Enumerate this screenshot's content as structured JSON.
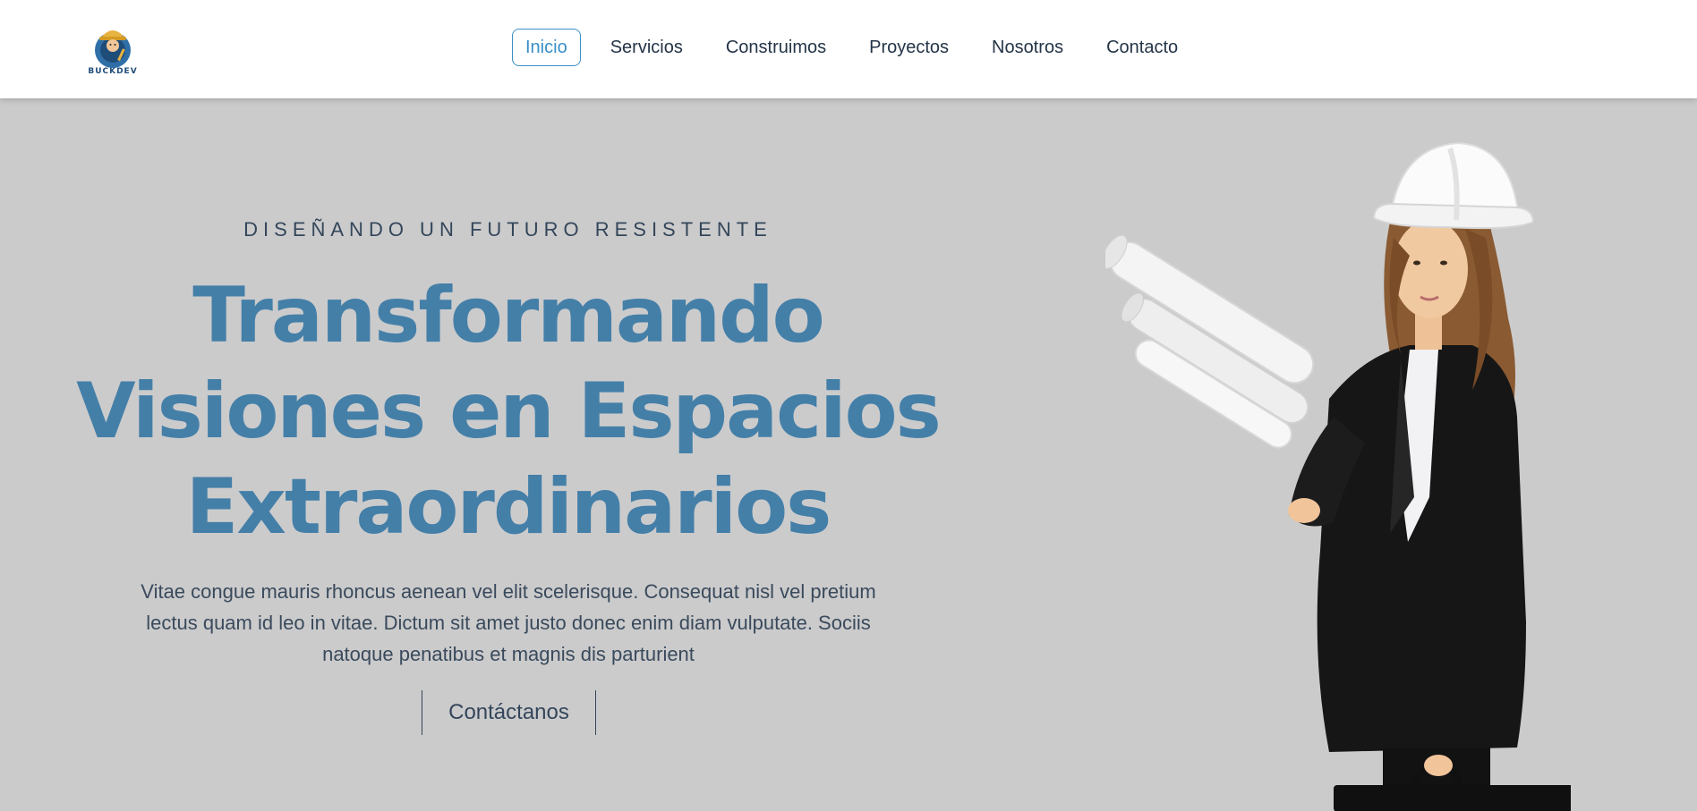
{
  "brand": {
    "logo_icon": "builder-mascot-logo-icon",
    "logo_text": "BUCKDEV"
  },
  "nav": {
    "items": [
      {
        "label": "Inicio",
        "active": true
      },
      {
        "label": "Servicios",
        "active": false
      },
      {
        "label": "Construimos",
        "active": false
      },
      {
        "label": "Proyectos",
        "active": false
      },
      {
        "label": "Nosotros",
        "active": false
      },
      {
        "label": "Contacto",
        "active": false
      }
    ]
  },
  "hero": {
    "eyebrow": "DISEÑANDO UN FUTURO RESISTENTE",
    "headline_lines": [
      "Transformando",
      "Visiones en Espacios",
      "Extraordinarios"
    ],
    "lead": "Vitae congue mauris rhoncus aenean vel elit scelerisque. Consequat nisl vel pretium lectus quam id leo in vitae. Dictum sit amet justo donec enim diam vulputate. Sociis natoque penatibus et magnis dis parturient",
    "cta_label": "Contáctanos",
    "image_icon": "engineer-woman-with-blueprints-image"
  },
  "colors": {
    "accent": "#3a8fc7",
    "headline": "#447fa8",
    "hero_background": "#cbcbcc",
    "text_dark": "#243447"
  }
}
